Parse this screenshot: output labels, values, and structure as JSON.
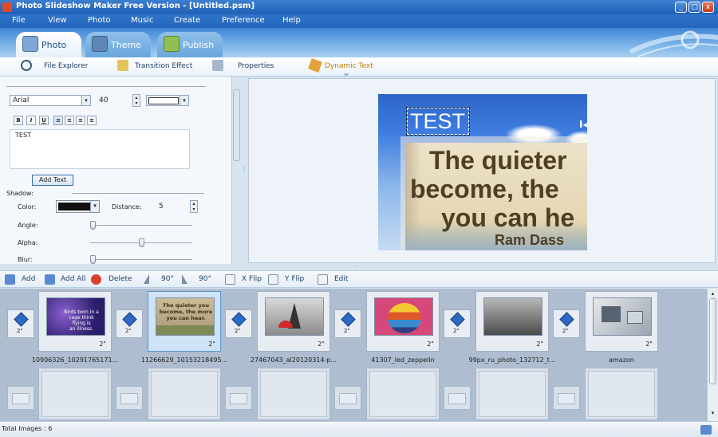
{
  "window": {
    "title": "Photo Slideshow Maker Free Version - [Untitled.psm]"
  },
  "menu": [
    "File",
    "View",
    "Photo",
    "Music",
    "Create",
    "Preference",
    "Help"
  ],
  "main_tabs": [
    {
      "label": "Photo"
    },
    {
      "label": "Theme"
    },
    {
      "label": "Publish"
    }
  ],
  "sub_tabs": [
    "File Explorer",
    "Transition Effect",
    "Properties",
    "Dynamic Text"
  ],
  "text_panel": {
    "font": "Arial",
    "font_size": "40",
    "format_buttons": [
      "B",
      "I",
      "U",
      "≡",
      "≡",
      "≡",
      "≡"
    ],
    "text_value": "TEST",
    "add_text_label": "Add Text",
    "shadow_label": "Shadow:",
    "color_label": "Color:",
    "distance_label": "Distance:",
    "distance_value": "5",
    "angle_label": "Angle:",
    "alpha_label": "Alpha:",
    "blur_label": "Blur:",
    "angle_value": 0.0,
    "alpha_value": 0.5,
    "blur_value": 0.0
  },
  "preview": {
    "overlay_text": "TEST",
    "quote_lines": [
      "The quieter",
      "become, the",
      "you can he"
    ],
    "quote_author": "Ram Dass"
  },
  "toolbar": [
    "Add",
    "Add All",
    "Delete",
    "90°",
    "90°",
    "X Flip",
    "Y Flip",
    "Edit"
  ],
  "gallery": {
    "items": [
      {
        "name": "10906326_10291765171...",
        "duration": "2\""
      },
      {
        "name": "11266629_10153218495...",
        "duration": "2\""
      },
      {
        "name": "27467043_al20120314-p...",
        "duration": "2\""
      },
      {
        "name": "41307_led_zeppelin",
        "duration": "2\""
      },
      {
        "name": "99px_ru_photo_132712_t...",
        "duration": "2\""
      },
      {
        "name": "amazon",
        "duration": "2\""
      }
    ],
    "transition_duration": "2\"",
    "thumb2_lines": [
      "The quieter you",
      "become, the more",
      "you can hear."
    ]
  },
  "status": {
    "text": "Total Images : 6"
  },
  "colors": {
    "title_blue": "#2466bd",
    "accent_orange": "#c87b00",
    "shadow_color": "#111111"
  }
}
